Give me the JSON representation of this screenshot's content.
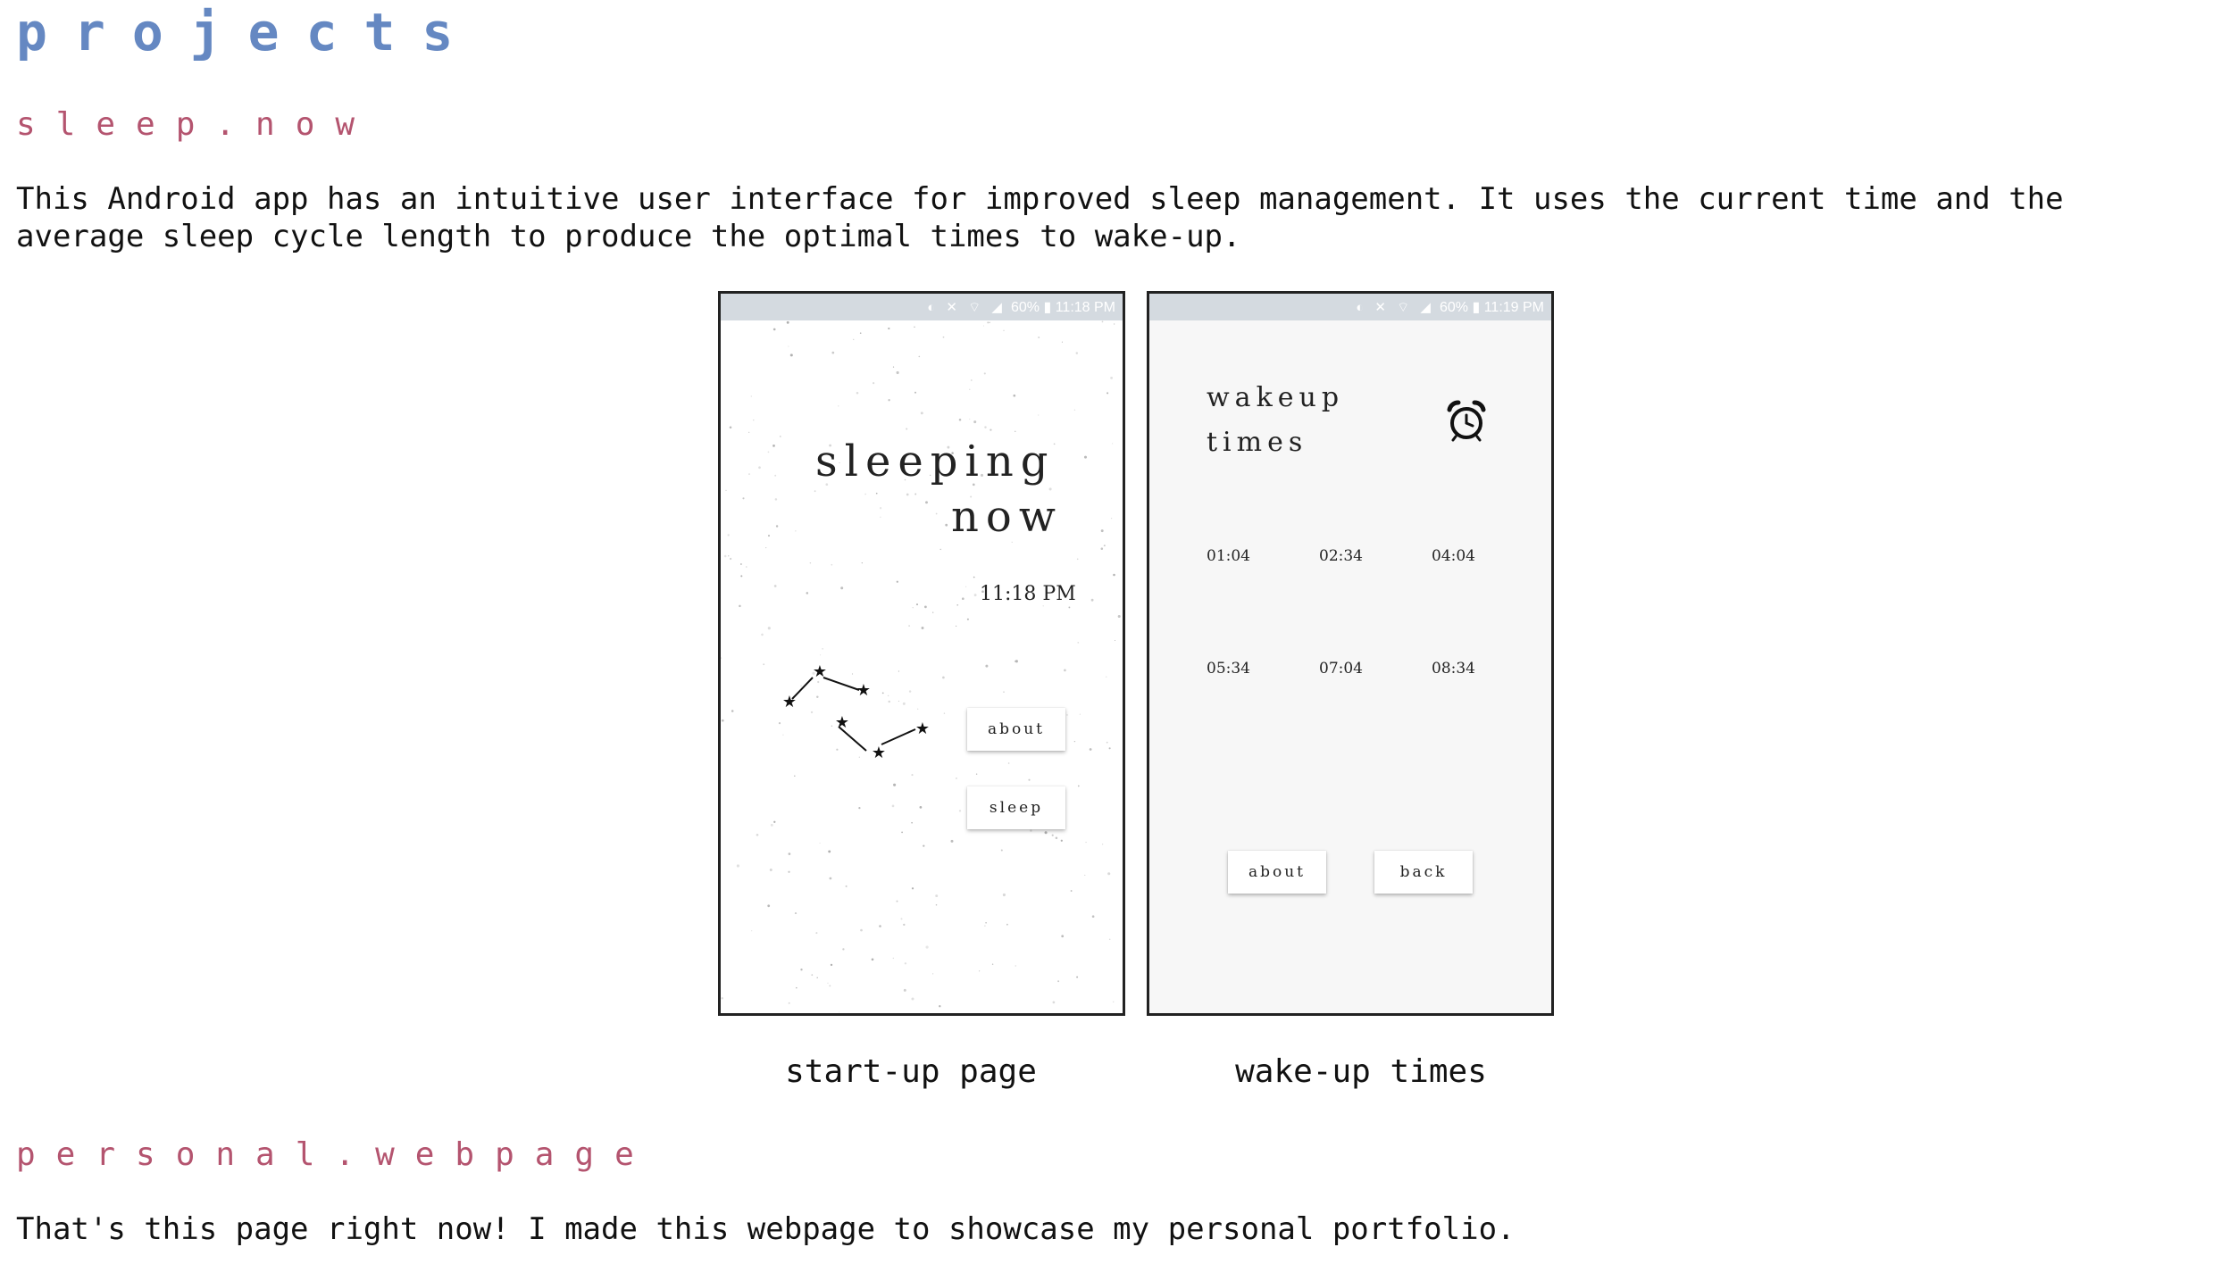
{
  "page": {
    "heading": "projects"
  },
  "projects": [
    {
      "title": "sleep.now",
      "description": "This Android app has an intuitive user interface for improved sleep management. It uses the current time and the average sleep cycle length to produce the optimal times to wake-up."
    },
    {
      "title": "personal.webpage",
      "description": "That's this page right now! I made this webpage to showcase my personal portfolio."
    }
  ],
  "screens": {
    "startup": {
      "status_text": "60% ▮ 11:18 PM",
      "title_line1": "sleeping",
      "title_line2": "now",
      "time": "11:18 PM",
      "about_label": "about",
      "sleep_label": "sleep",
      "caption": "start-up page",
      "star_icon": "star-icon"
    },
    "wakeup": {
      "status_text": "60% ▮ 11:19 PM",
      "title_line1": "wakeup",
      "title_line2": "times",
      "alarm_icon": "alarm-clock-icon",
      "times": [
        "01:04",
        "02:34",
        "04:04",
        "05:34",
        "07:04",
        "08:34"
      ],
      "about_label": "about",
      "back_label": "back",
      "caption": "wake-up times"
    }
  },
  "colors": {
    "heading": "#6588c2",
    "section_title": "#b4546f",
    "statusbar": "#d4dae0",
    "wake_bg": "#f7f7f7"
  }
}
